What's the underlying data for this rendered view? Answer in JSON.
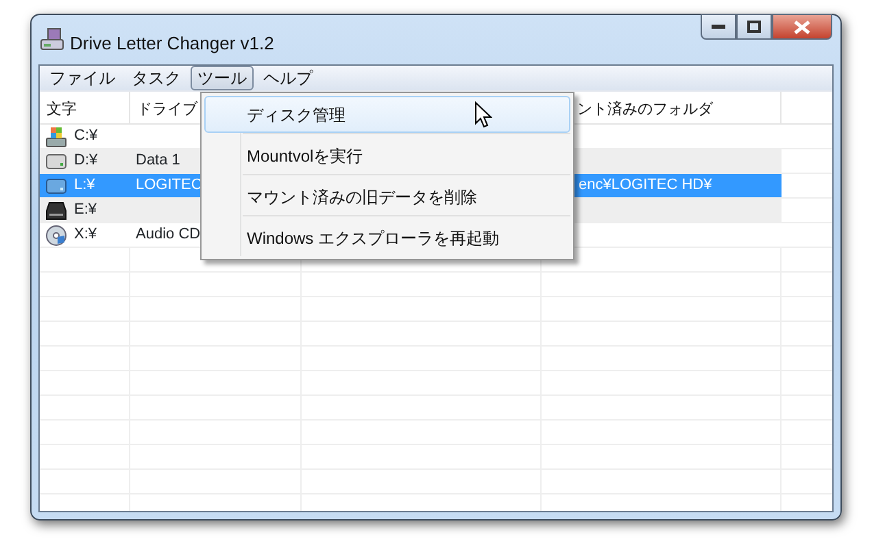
{
  "window": {
    "title": "Drive Letter Changer v1.2"
  },
  "menu": [
    {
      "label": "ファイル",
      "selected": false
    },
    {
      "label": "タスク",
      "selected": false
    },
    {
      "label": "ツール",
      "selected": true
    },
    {
      "label": "ヘルプ",
      "selected": false
    }
  ],
  "table": {
    "columns": [
      {
        "label": "文字"
      },
      {
        "label": "ドライブ"
      },
      {},
      {
        "label": "ント済みのフォルダ"
      },
      {}
    ],
    "rows": [
      {
        "kind": "system",
        "letter": "C:¥",
        "selected": false
      },
      {
        "kind": "hdd",
        "letter": "D:¥",
        "label": "Data 1",
        "selected": false
      },
      {
        "kind": "usb",
        "letter": "L:¥",
        "label": "LOGITEC",
        "folder": "enc¥LOGITEC HD¥",
        "selected": true
      },
      {
        "kind": "removable",
        "letter": "E:¥",
        "selected": false
      },
      {
        "kind": "cd",
        "letter": "X:¥",
        "label": "Audio CD",
        "selected": false
      }
    ]
  },
  "dropdown": {
    "items": [
      {
        "label": "ディスク管理",
        "highlighted": true
      },
      {
        "label": "Mountvolを実行",
        "highlighted": false
      },
      {
        "label": "マウント済みの旧データを削除",
        "highlighted": false
      },
      {
        "label": "Windows エクスプローラを再起動",
        "highlighted": false
      }
    ]
  }
}
